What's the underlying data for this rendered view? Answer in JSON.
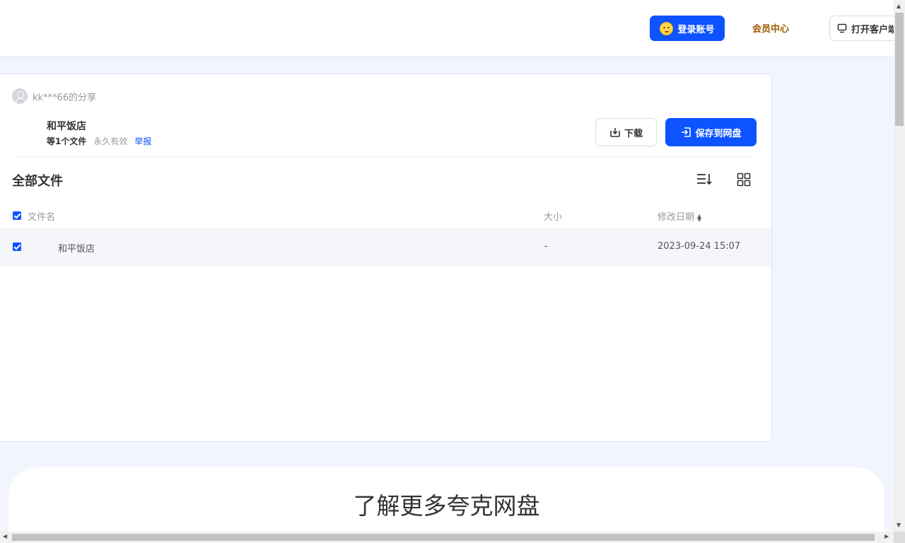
{
  "header": {
    "login_label": "登录账号",
    "vip_label": "会员中心",
    "client_label": "打开客户端"
  },
  "share": {
    "sharer": "kk***66的分享",
    "title": "和平饭店",
    "file_count": "等1个文件",
    "expire": "永久有效",
    "report": "举报",
    "download_label": "下载",
    "save_label": "保存到网盘"
  },
  "files": {
    "section_title": "全部文件",
    "columns": {
      "name": "文件名",
      "size": "大小",
      "date": "修改日期"
    },
    "rows": [
      {
        "name": "和平饭店",
        "size": "-",
        "date": "2023-09-24 15:07"
      }
    ]
  },
  "promo": {
    "title": "了解更多夸克网盘"
  },
  "colors": {
    "accent": "#0d53ff",
    "vip": "#a05a00",
    "background": "#f2f5fd"
  }
}
